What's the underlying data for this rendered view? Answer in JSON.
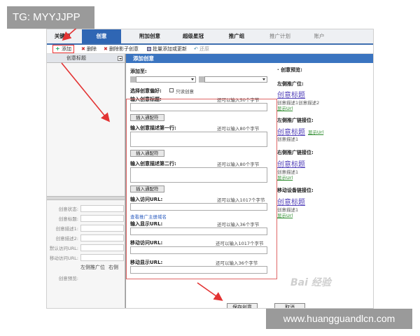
{
  "watermarks": {
    "top_left": "TG: MYYJJPP",
    "bottom_right": "www.huangguandlcn.com",
    "baidu": "Bai 经验"
  },
  "tabs": [
    {
      "label": "关键词",
      "active": false
    },
    {
      "label": "创意",
      "active": true
    },
    {
      "label": "附加创意",
      "active": false
    },
    {
      "label": "超级星冠",
      "active": false
    },
    {
      "label": "推广组",
      "active": false
    },
    {
      "label": "推广计划",
      "active": false
    },
    {
      "label": "账户",
      "active": false
    }
  ],
  "toolbar": {
    "add": "添加",
    "delete": "删除",
    "delete_sub": "删除影子创意",
    "batch": "批量添加或更新",
    "restore": "还原"
  },
  "left": {
    "column_header": "创意标题",
    "fields": [
      "创意状态:",
      "创意标题:",
      "创意描述1:",
      "创意描述2:",
      "默认访问URL:",
      "移动访问URL:"
    ],
    "tabs": [
      "左侧推广位",
      "右侧"
    ],
    "preview_label": "创意预览:"
  },
  "dialog": {
    "title": "添加创意",
    "add_to": "添加至:",
    "preference_label": "选择创意偏好:",
    "preference_option": "只读创意",
    "fields": [
      {
        "label": "输入创意标题:",
        "hint": "还可以输入50个字节",
        "button": "插入通配符"
      },
      {
        "label": "输入创意描述第一行:",
        "hint": "还可以输入80个字节",
        "button": "插入通配符"
      },
      {
        "label": "输入创意描述第二行:",
        "hint": "还可以输入80个字节",
        "button": "插入通配符"
      }
    ],
    "visit_url_label": "输入访问URL:",
    "visit_url_hint": "还可以输入1017个字节",
    "view_domain_link": "查看推广主册域名",
    "display_url_label": "输入显示URL:",
    "display_url_hint": "还可以输入36个字节",
    "mobile_visit_label": "移动访问URL:",
    "mobile_visit_hint": "还可以输入1017个字节",
    "mobile_display_label": "移动显示URL:",
    "mobile_display_hint": "还可以输入36个字节",
    "save": "保存创意",
    "cancel": "取消"
  },
  "preview": {
    "heading": "· 创意预览:",
    "sections": [
      {
        "label": "左侧推广位:",
        "title": "创意标题",
        "desc": "创意描述1创意描述2",
        "url": "显示Url",
        "url_inline": false
      },
      {
        "label": "左侧推广链接位:",
        "title": "创意标题",
        "desc": "创意描述1",
        "url": "显示Url",
        "url_inline": true
      },
      {
        "label": "右侧推广链接位:",
        "title": "创意标题",
        "desc": "创意描述1",
        "url": "显示Url",
        "url_inline": false
      },
      {
        "label": "移动设备链接位:",
        "title": "创意标题",
        "desc": "创意描述1",
        "url": "显示Url",
        "url_inline": false
      }
    ]
  },
  "colors": {
    "accent": "#2f66b4",
    "annotation": "#e33333",
    "frame": "#e06666"
  }
}
